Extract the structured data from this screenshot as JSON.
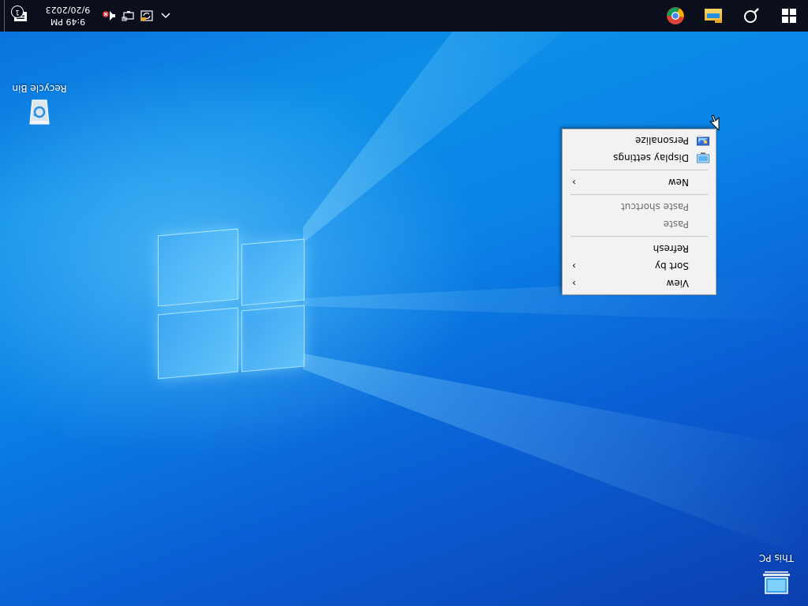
{
  "desktop": {
    "icons": [
      {
        "label": "This PC",
        "icon": "this-pc-icon"
      },
      {
        "label": "Recycle Bin",
        "icon": "recycle-bin-icon"
      }
    ]
  },
  "context_menu": {
    "items": [
      {
        "label": "View",
        "has_submenu": true,
        "enabled": true
      },
      {
        "label": "Sort by",
        "has_submenu": true,
        "enabled": true
      },
      {
        "label": "Refresh",
        "has_submenu": false,
        "enabled": true
      },
      {
        "label": "Paste",
        "has_submenu": false,
        "enabled": false
      },
      {
        "label": "Paste shortcut",
        "has_submenu": false,
        "enabled": false
      },
      {
        "label": "New",
        "has_submenu": true,
        "enabled": true
      },
      {
        "label": "Display settings",
        "icon": "display-settings-icon",
        "enabled": true
      },
      {
        "label": "Personalize",
        "icon": "personalize-icon",
        "enabled": true
      }
    ],
    "arrow_glyph": "›"
  },
  "taskbar": {
    "pinned": [
      {
        "name": "start",
        "icon": "windows-start-icon"
      },
      {
        "name": "search",
        "icon": "search-icon"
      },
      {
        "name": "file-explorer",
        "icon": "folder-icon"
      },
      {
        "name": "chrome",
        "icon": "chrome-icon"
      }
    ],
    "tray": {
      "chevron": "chevron-up-icon",
      "icons": [
        "sync-icon",
        "network-icon",
        "volume-muted-icon"
      ],
      "time": "9:49 PM",
      "date": "9/20/2023",
      "notifications": "1"
    }
  },
  "colors": {
    "taskbar_bg": "#0b0f1c",
    "menu_bg": "#f2f2f2",
    "accent": "#0a82e6"
  }
}
